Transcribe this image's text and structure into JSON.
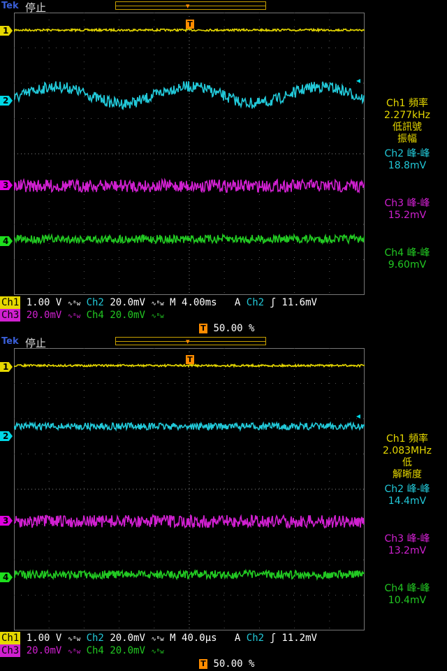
{
  "panels": [
    {
      "brand": "Tek",
      "state": "停止",
      "trigger_badge": "T",
      "readouts": [
        {
          "line1": "Ch1 頻率",
          "line2": "2.277kHz",
          "line3": "低訊號",
          "line4": "振幅"
        },
        {
          "line1": "Ch2 峰-峰",
          "line2": "18.8mV"
        },
        {
          "line1": "Ch3 峰-峰",
          "line2": "15.2mV"
        },
        {
          "line1": "Ch4 峰-峰",
          "line2": "9.60mV"
        }
      ],
      "status": {
        "ch1": "Ch1",
        "ch1_scale": "1.00 V",
        "ch2": "Ch2",
        "ch2_scale": "20.0mV",
        "ch3": "Ch3",
        "ch3_scale": "20.0mV",
        "ch4": "Ch4",
        "ch4_scale": "20.0mV",
        "bw": "∿ᴮw",
        "timebase": "M 4.00ms",
        "trig_mode": "A",
        "trig_src": "Ch2",
        "trig_slope": "ʃ",
        "trig_level": "11.6mV",
        "trig_pos": "50.00 %"
      },
      "markers": [
        "1",
        "2",
        "3",
        "4"
      ],
      "wave_type": "sine"
    },
    {
      "brand": "Tek",
      "state": "停止",
      "trigger_badge": "T",
      "readouts": [
        {
          "line1": "Ch1 頻率",
          "line2": "2.083MHz",
          "line3": "低",
          "line4": "解晰度"
        },
        {
          "line1": "Ch2 峰-峰",
          "line2": "14.4mV"
        },
        {
          "line1": "Ch3 峰-峰",
          "line2": "13.2mV"
        },
        {
          "line1": "Ch4 峰-峰",
          "line2": "10.4mV"
        }
      ],
      "status": {
        "ch1": "Ch1",
        "ch1_scale": "1.00 V",
        "ch2": "Ch2",
        "ch2_scale": "20.0mV",
        "ch3": "Ch3",
        "ch3_scale": "20.0mV",
        "ch4": "Ch4",
        "ch4_scale": "20.0mV",
        "bw": "∿ᴮw",
        "timebase": "M 40.0µs",
        "trig_mode": "A",
        "trig_src": "Ch2",
        "trig_slope": "ʃ",
        "trig_level": "11.2mV",
        "trig_pos": "50.00 %"
      },
      "markers": [
        "1",
        "2",
        "3",
        "4"
      ],
      "wave_type": "flat"
    }
  ],
  "colors": {
    "ch1": "#e6d800",
    "ch2": "#22c8d8",
    "ch3": "#d020d0",
    "ch4": "#22c822",
    "grid": "#555555"
  }
}
